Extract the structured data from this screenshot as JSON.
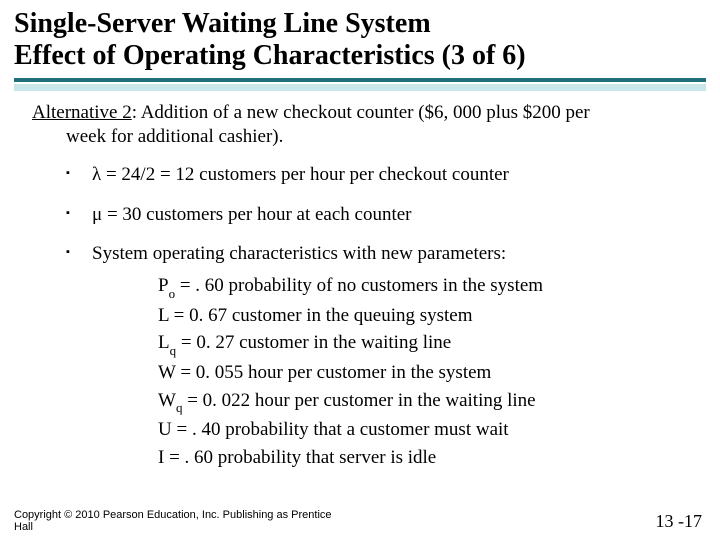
{
  "title": {
    "line1": "Single-Server Waiting Line System",
    "line2": "Effect of Operating Characteristics (3 of 6)"
  },
  "alternative": {
    "label": "Alternative 2",
    "text_a": ": Addition of a new checkout counter ($6, 000 plus $200 per",
    "text_b": "week for additional cashier)."
  },
  "bullets": {
    "b1_pre": "λ",
    "b1_post": " = 24/2 = 12 customers per hour per checkout counter",
    "b2_pre": "μ",
    "b2_post": " = 30 customers per hour at each counter",
    "b3": "System operating characteristics with new parameters:"
  },
  "metrics": {
    "r1_sym": "P",
    "r1_sub": "o",
    "r1_rest": " = . 60 probability of no customers in the system",
    "r2_sym": "L",
    "r2_rest": " = 0. 67 customer in the queuing system",
    "r3_sym": "L",
    "r3_sub": "q",
    "r3_rest": " = 0. 27 customer in the waiting line",
    "r4_sym": "W",
    "r4_rest": " = 0. 055 hour per customer in the system",
    "r5_sym": "W",
    "r5_sub": "q",
    "r5_rest": " = 0. 022 hour per customer in the waiting line",
    "r6_sym": "U",
    "r6_rest": " = . 40 probability that a customer must wait",
    "r7_sym": "I ",
    "r7_rest": " = . 60 probability that server is idle"
  },
  "footer": {
    "copyright_a": "Copyright © 2010 Pearson Education, Inc. Publishing as Prentice",
    "copyright_b": "Hall",
    "page": "13 -17"
  }
}
